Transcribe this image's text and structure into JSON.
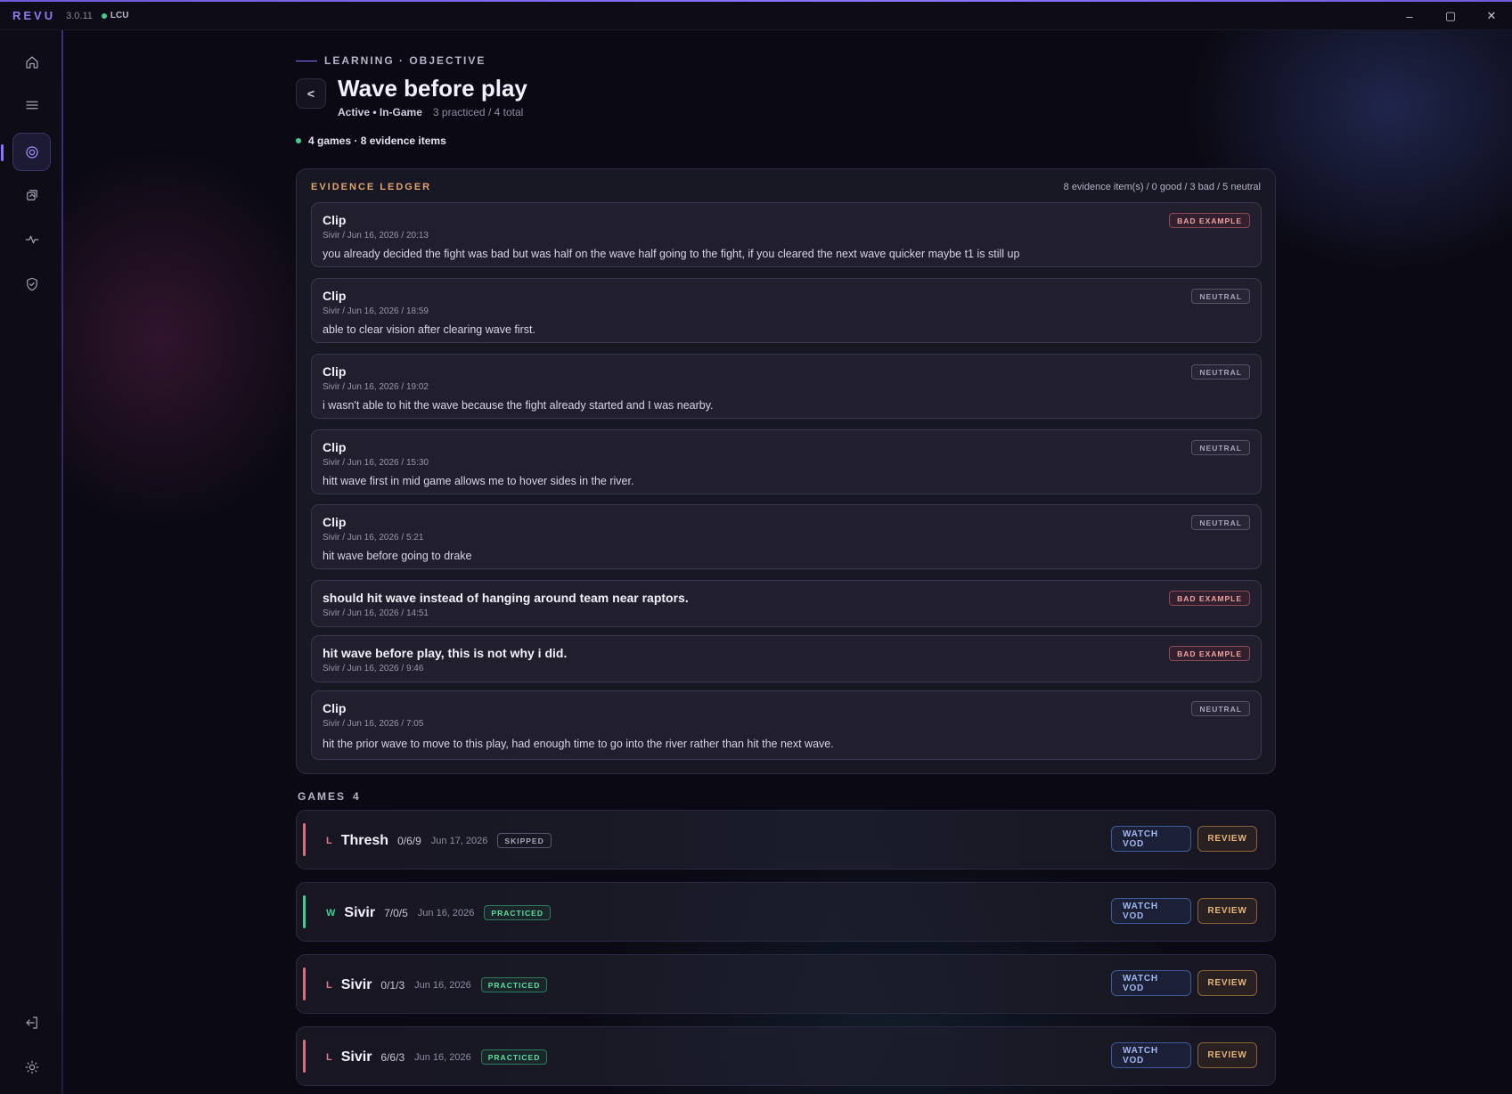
{
  "app": {
    "brand": "REVU",
    "version": "3.0.11",
    "connection": "LCU"
  },
  "window_controls": {
    "minimize": "–",
    "maximize": "▢",
    "close": "✕"
  },
  "sidebar": {
    "items": [
      {
        "name": "home",
        "icon": "home-icon",
        "active": false
      },
      {
        "name": "list",
        "icon": "list-icon",
        "active": false
      },
      {
        "name": "objectives",
        "icon": "target-icon",
        "active": true
      },
      {
        "name": "library",
        "icon": "copy-icon",
        "active": false
      },
      {
        "name": "activity",
        "icon": "pulse-icon",
        "active": false
      },
      {
        "name": "shield",
        "icon": "shield-icon",
        "active": false
      }
    ],
    "bottom": [
      {
        "name": "logout",
        "icon": "logout-icon"
      },
      {
        "name": "settings",
        "icon": "sun-icon"
      }
    ]
  },
  "page": {
    "eyebrow": "LEARNING · OBJECTIVE",
    "back_label": "<",
    "title": "Wave before play",
    "status": "Active • In-Game",
    "practice_count": "3 practiced / 4 total",
    "summary": "4 games · 8 evidence items"
  },
  "ledger": {
    "title": "EVIDENCE LEDGER",
    "stats": "8 evidence item(s) / 0 good / 3 bad / 5 neutral",
    "items": [
      {
        "title": "Clip",
        "meta": "Sivir / Jun 16, 2026 / 20:13",
        "text": "you already decided the fight was bad but was half on the wave half going to the fight, if you cleared the next wave quicker maybe t1 is still up",
        "badge": "BAD EXAMPLE",
        "kind": "bad"
      },
      {
        "title": "Clip",
        "meta": "Sivir / Jun 16, 2026 / 18:59",
        "text": "able to clear vision after clearing wave first.",
        "badge": "NEUTRAL",
        "kind": "neutral"
      },
      {
        "title": "Clip",
        "meta": "Sivir / Jun 16, 2026 / 19:02",
        "text": "i wasn't able to hit the wave because the fight already started and I was nearby.",
        "badge": "NEUTRAL",
        "kind": "neutral"
      },
      {
        "title": "Clip",
        "meta": "Sivir / Jun 16, 2026 / 15:30",
        "text": "hitt wave first in mid game allows me to hover sides in the river.",
        "badge": "NEUTRAL",
        "kind": "neutral"
      },
      {
        "title": "Clip",
        "meta": "Sivir / Jun 16, 2026 / 5:21",
        "text": "hit wave before going to drake",
        "badge": "NEUTRAL",
        "kind": "neutral"
      },
      {
        "title": "should hit wave instead of hanging around team near raptors.",
        "meta": "Sivir / Jun 16, 2026 / 14:51",
        "text": "",
        "badge": "BAD EXAMPLE",
        "kind": "bad"
      },
      {
        "title": "hit wave before play, this is not why i did.",
        "meta": "Sivir / Jun 16, 2026 / 9:46",
        "text": "",
        "badge": "BAD EXAMPLE",
        "kind": "bad"
      },
      {
        "title": "Clip",
        "meta": "Sivir / Jun 16, 2026 / 7:05",
        "text": "hit the prior wave to move to this play, had enough time to go into the river rather than hit the next wave.",
        "badge": "NEUTRAL",
        "kind": "neutral"
      }
    ]
  },
  "games": {
    "label": "GAMES",
    "count": "4",
    "items": [
      {
        "result": "L",
        "champion": "Thresh",
        "kda": "0/6/9",
        "date": "Jun 17, 2026",
        "status": "SKIPPED",
        "vod": "WATCH VOD",
        "review": "REVIEW"
      },
      {
        "result": "W",
        "champion": "Sivir",
        "kda": "7/0/5",
        "date": "Jun 16, 2026",
        "status": "PRACTICED",
        "vod": "WATCH VOD",
        "review": "REVIEW"
      },
      {
        "result": "L",
        "champion": "Sivir",
        "kda": "0/1/3",
        "date": "Jun 16, 2026",
        "status": "PRACTICED",
        "vod": "WATCH VOD",
        "review": "REVIEW"
      },
      {
        "result": "L",
        "champion": "Sivir",
        "kda": "6/6/3",
        "date": "Jun 16, 2026",
        "status": "PRACTICED",
        "vod": "WATCH VOD",
        "review": "REVIEW"
      }
    ]
  }
}
